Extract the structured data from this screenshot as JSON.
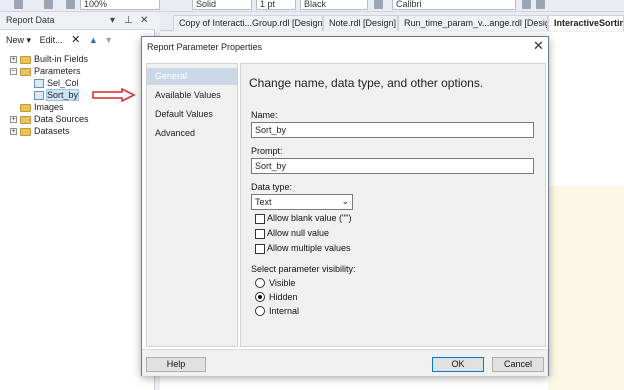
{
  "toolbar": {
    "zoom": "100%",
    "line_style": "Solid",
    "line_width": "1 pt",
    "color": "Black",
    "font": "Calibri"
  },
  "report_data": {
    "title": "Report Data",
    "new_label": "New",
    "edit_label": "Edit...",
    "tree": {
      "built_in_fields": "Built-in Fields",
      "parameters": "Parameters",
      "params": [
        "Sel_Col",
        "Sort_by"
      ],
      "images": "Images",
      "data_sources": "Data Sources",
      "datasets": "Datasets"
    }
  },
  "tabs": [
    "Copy of Interacti...Group.rdl [Design]",
    "Note.rdl [Design]",
    "Run_time_param_v...ange.rdl [Design]",
    "InteractiveSortin..."
  ],
  "dialog": {
    "title": "Report Parameter Properties",
    "nav": [
      "General",
      "Available Values",
      "Default Values",
      "Advanced"
    ],
    "heading": "Change name, data type, and other options.",
    "name_label": "Name:",
    "name_value": "Sort_by",
    "prompt_label": "Prompt:",
    "prompt_value": "Sort_by",
    "data_type_label": "Data type:",
    "data_type_value": "Text",
    "checkboxes": [
      "Allow blank value (\"\")",
      "Allow null value",
      "Allow multiple values"
    ],
    "visibility_label": "Select parameter visibility:",
    "visibility_options": [
      "Visible",
      "Hidden",
      "Internal"
    ],
    "visibility_selected": "Hidden",
    "help_label": "Help",
    "ok_label": "OK",
    "cancel_label": "Cancel"
  },
  "colors": {
    "arrow": "#d62828",
    "nav_selected": "#c9d7e6",
    "focus_border": "#0078d7"
  }
}
